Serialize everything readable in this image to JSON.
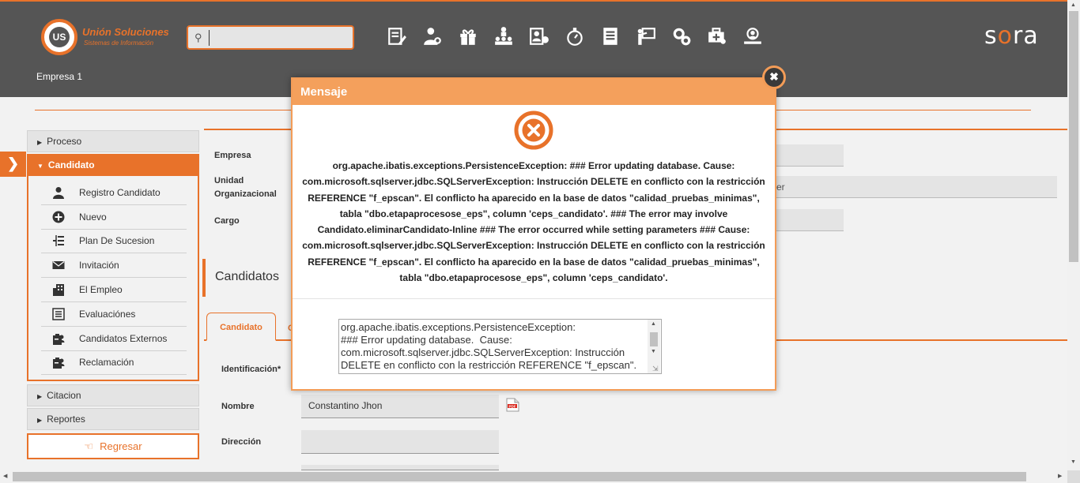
{
  "header": {
    "logo_initials": "US",
    "logo_title": "Unión Soluciones",
    "logo_subtitle": "Sistemas de Información",
    "search_value": "",
    "brand_prefix": "s",
    "brand_accent": "o",
    "brand_suffix": "ra",
    "company": "Empresa 1",
    "tool_icons": [
      "form-edit-icon",
      "user-settings-icon",
      "gift-icon",
      "org-chart-icon",
      "user-card-icon",
      "stopwatch-icon",
      "document-list-icon",
      "presentation-icon",
      "gears-icon",
      "medical-bag-icon",
      "user-search-icon"
    ]
  },
  "sidebar": {
    "drawer_arrow": "❯",
    "groups": [
      {
        "label": "Proceso",
        "expanded": false
      },
      {
        "label": "Candidato",
        "expanded": true
      },
      {
        "label": "Citacion",
        "expanded": false
      },
      {
        "label": "Reportes",
        "expanded": false
      }
    ],
    "candidato_items": [
      {
        "label": "Registro Candidato",
        "icon": "user-icon"
      },
      {
        "label": "Nuevo",
        "icon": "plus-circle-icon"
      },
      {
        "label": "Plan De Sucesion",
        "icon": "hierarchy-icon"
      },
      {
        "label": "Invitación",
        "icon": "envelope-icon"
      },
      {
        "label": "El Empleo",
        "icon": "building-icon"
      },
      {
        "label": "Evaluaciónes",
        "icon": "list-icon"
      },
      {
        "label": "Candidatos Externos",
        "icon": "clipboard-user-icon"
      },
      {
        "label": "Reclamación",
        "icon": "clipboard-user-icon"
      }
    ],
    "back_label": "Regresar"
  },
  "form": {
    "empresa_label": "Empresa",
    "unidad_label_1": "Unidad",
    "unidad_label_2": "Organizacional",
    "unidad_value_fragment": "er",
    "cargo_label": "Cargo",
    "section_title": "Candidatos",
    "tab_active": "Candidato",
    "tab_next_fragment": "C",
    "identificacion_label": "Identificación*",
    "nombre_label": "Nombre",
    "nombre_value": "Constantino  Jhon",
    "direccion_label": "Dirección",
    "direccion_value": ""
  },
  "modal": {
    "title": "Mensaje",
    "close_symbol": "✖",
    "message": "org.apache.ibatis.exceptions.PersistenceException: ### Error updating database. Cause: com.microsoft.sqlserver.jdbc.SQLServerException: Instrucción DELETE en conflicto con la restricción REFERENCE \"f_epscan\". El conflicto ha aparecido en la base de datos \"calidad_pruebas_minimas\", tabla \"dbo.etapaprocesose_eps\", column 'ceps_candidato'. ### The error may involve Candidato.eliminarCandidato-Inline ### The error occurred while setting parameters ### Cause: com.microsoft.sqlserver.jdbc.SQLServerException: Instrucción DELETE en conflicto con la restricción REFERENCE \"f_epscan\". El conflicto ha aparecido en la base de datos \"calidad_pruebas_minimas\", tabla \"dbo.etapaprocesose_eps\", column 'ceps_candidato'.",
    "detail": "org.apache.ibatis.exceptions.PersistenceException: \n### Error updating database.  Cause: com.microsoft.sqlserver.jdbc.SQLServerException: Instrucción DELETE en conflicto con la restricción REFERENCE \"f_epscan\"."
  },
  "colors": {
    "accent": "#e8722a",
    "header_bg": "#555555",
    "modal_header": "#f4a05c"
  }
}
